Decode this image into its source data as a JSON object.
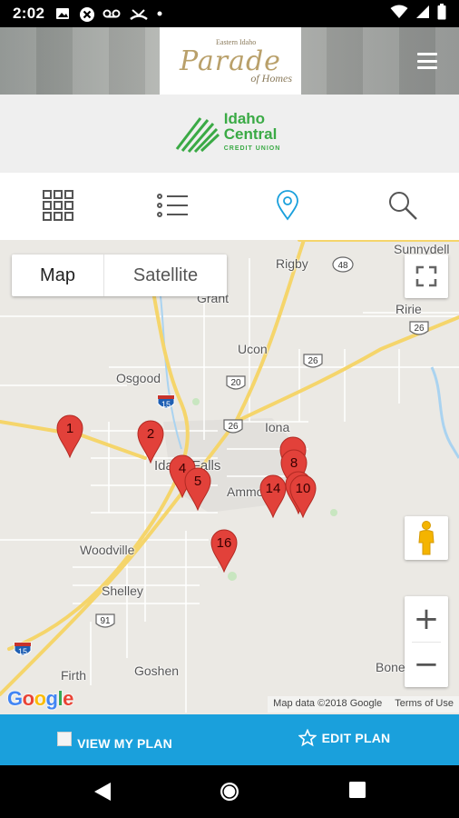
{
  "status_bar": {
    "time": "2:02",
    "icons": [
      "image-icon",
      "block-icon",
      "voicemail-icon",
      "missed-call-icon",
      "dot-icon",
      "wifi-icon",
      "signal-icon",
      "battery-icon"
    ]
  },
  "header": {
    "logo_top": "Eastern Idaho",
    "logo_main": "Parade",
    "logo_tail": "of Homes",
    "menu_icon": "hamburger-icon"
  },
  "sponsor": {
    "line1": "Idaho",
    "line2": "Central",
    "line3": "CREDIT UNION",
    "color": "#3aaa45"
  },
  "view_toolbar": {
    "items": [
      {
        "icon": "grid-icon",
        "active": false
      },
      {
        "icon": "list-icon",
        "active": false
      },
      {
        "icon": "map-pin-icon",
        "active": true
      },
      {
        "icon": "search-icon",
        "active": false
      }
    ],
    "active_color": "#1aa0dc"
  },
  "map": {
    "type_control": {
      "map_label": "Map",
      "satellite_label": "Satellite",
      "selected": "Map"
    },
    "places": {
      "sunnydell": "Sunnydell",
      "rigby": "Rigby",
      "grant": "Grant",
      "ririe": "Ririe",
      "ucon": "Ucon",
      "osgood": "Osgood",
      "iona": "Iona",
      "idaho_falls": "Idaho Falls",
      "ammon": "Ammon",
      "woodville": "Woodville",
      "shelley": "Shelley",
      "firth": "Firth",
      "goshen": "Goshen",
      "bone": "Bone"
    },
    "route_shields": {
      "r48": "48",
      "r26_east": "26",
      "r26_mid": "26",
      "r26_center": "26",
      "r20": "20",
      "i15_north": "15",
      "i15_south": "15",
      "r91": "91"
    },
    "markers": [
      "1",
      "2",
      "4",
      "5",
      "14",
      "8",
      "10",
      "16"
    ],
    "marker_color": "#e2413a",
    "attribution": {
      "google": "Google",
      "map_data": "Map data ©2018 Google",
      "terms": "Terms of Use"
    }
  },
  "plan_bar": {
    "view_label": "VIEW MY PLAN",
    "edit_label": "EDIT PLAN",
    "background": "#1aa0dc"
  },
  "nav_bar": {
    "icons": [
      "back-icon",
      "home-icon",
      "recents-icon"
    ]
  }
}
